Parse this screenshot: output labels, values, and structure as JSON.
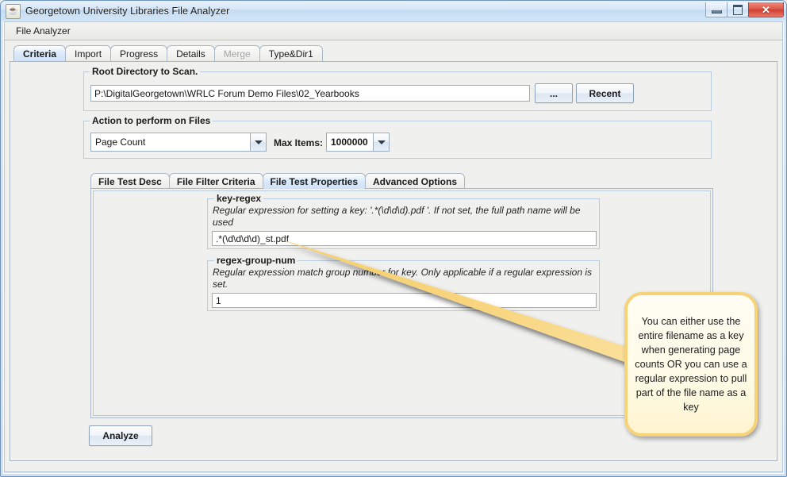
{
  "window": {
    "title": "Georgetown University Libraries File Analyzer",
    "icon": "java-cup-icon",
    "controls": {
      "minimize": "minimize-button",
      "maximize": "maximize-button",
      "close_glyph": "✕"
    }
  },
  "menubar": {
    "items": [
      "File Analyzer"
    ]
  },
  "tabs": [
    {
      "label": "Criteria",
      "selected": true,
      "disabled": false
    },
    {
      "label": "Import",
      "selected": false,
      "disabled": false
    },
    {
      "label": "Progress",
      "selected": false,
      "disabled": false
    },
    {
      "label": "Details",
      "selected": false,
      "disabled": false
    },
    {
      "label": "Merge",
      "selected": false,
      "disabled": true
    },
    {
      "label": "Type&Dir1",
      "selected": false,
      "disabled": false
    }
  ],
  "root_directory": {
    "group_title": "Root Directory to Scan.",
    "path_value": "P:\\DigitalGeorgetown\\WRLC Forum Demo Files\\02_Yearbooks",
    "path_placeholder": "",
    "browse_label": "...",
    "recent_label": "Recent"
  },
  "action": {
    "group_title": "Action to perform on Files",
    "action_value": "Page Count",
    "max_items_label": "Max Items:",
    "max_items_value": "1000000"
  },
  "inner_tabs": [
    {
      "label": "File Test Desc",
      "selected": false
    },
    {
      "label": "File Filter Criteria",
      "selected": false
    },
    {
      "label": "File Test Properties",
      "selected": true
    },
    {
      "label": "Advanced Options",
      "selected": false
    }
  ],
  "properties": [
    {
      "name": "key-regex",
      "description": "Regular expression for setting a key: '.*(\\d\\d\\d).pdf '.  If not set, the full path name will be used",
      "value": ".*(\\d\\d\\d\\d)_st.pdf"
    },
    {
      "name": "regex-group-num",
      "description": "Regular expression match group number for key.  Only applicable if a regular expression is set.",
      "value": "1"
    }
  ],
  "analyze_button": {
    "label": "Analyze"
  },
  "callout": {
    "text": "You can either use the entire filename as a key when generating page counts OR you can use a regular expression to pull part of the file name as a key",
    "border_color": "#f7d276",
    "fill_color": "#fffbe6"
  },
  "colors": {
    "selected_tab": "#cfe2f8",
    "panel": "#f0f0ef",
    "border": "#a9b7c6",
    "group_border": "#b8cadd",
    "titlebar_top": "#e8f1fa",
    "close_button": "#df5a4c"
  }
}
